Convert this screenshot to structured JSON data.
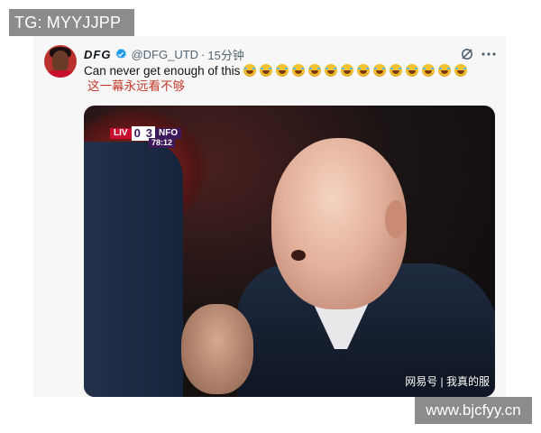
{
  "watermarks": {
    "top": "TG: MYYJJPP",
    "bottom": "www.bjcfyy.cn"
  },
  "tweet": {
    "display_name": "DFG",
    "handle": "@DFG_UTD",
    "separator": "·",
    "time": "15分钟",
    "text": "Can never get enough of this",
    "emoji_count": 14,
    "translation": "这一幕永远看不够"
  },
  "media": {
    "scorebug": {
      "home": "LIV",
      "home_score": "0",
      "away_score": "3",
      "away": "NFO",
      "clock": "78:12"
    },
    "watermark": "网易号 | 我真的服"
  },
  "icons": [
    "verified-badge-icon",
    "grok-icon",
    "more-options-icon"
  ],
  "colors": {
    "accent": "#1d9bf0",
    "translation": "#c33b2b",
    "premier_league_purple": "#3d195b",
    "liverpool_red": "#c8102e"
  }
}
